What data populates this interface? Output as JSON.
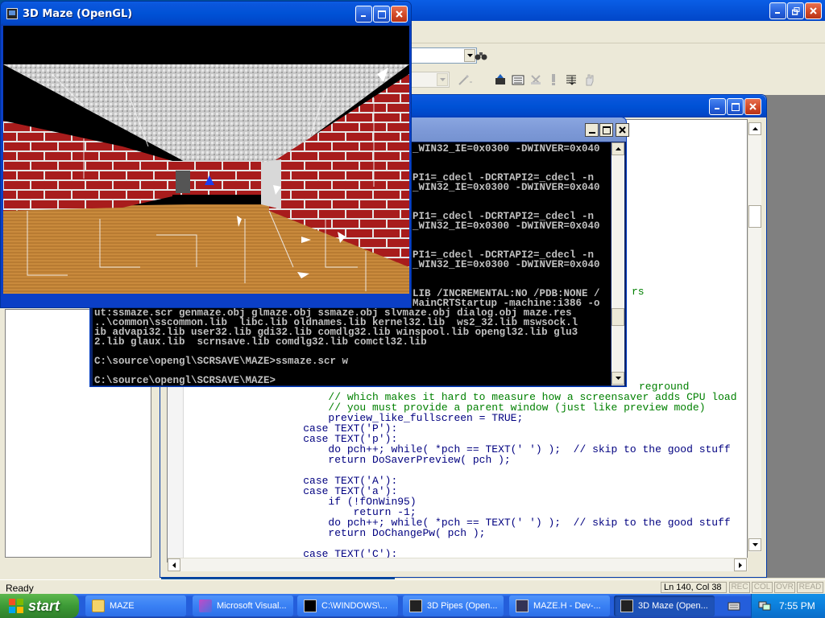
{
  "maze_window": {
    "title": "3D Maze (OpenGL)"
  },
  "devcpp": {
    "status_ready": "Ready",
    "status_pos": "Ln 140, Col 38",
    "indicators": [
      "REC",
      "COL",
      "OVR",
      "READ"
    ],
    "code_lines": [
      {
        "t": "                       // which makes it hard to measure how a screensaver adds CPU load",
        "c": "comment"
      },
      {
        "t": "                       // you must provide a parent window (just like preview mode)",
        "c": "comment"
      },
      {
        "t": "                       preview_like_fullscreen = TRUE;",
        "c": "code"
      },
      {
        "t": "                   case TEXT('P'):",
        "c": "code"
      },
      {
        "t": "                   case TEXT('p'):",
        "c": "code"
      },
      {
        "t": "                       do pch++; while( *pch == TEXT(' ') );  // skip to the good stuff",
        "c": "code"
      },
      {
        "t": "                       return DoSaverPreview( pch );",
        "c": "code"
      },
      {
        "t": "",
        "c": "code"
      },
      {
        "t": "                   case TEXT('A'):",
        "c": "code"
      },
      {
        "t": "                   case TEXT('a'):",
        "c": "code"
      },
      {
        "t": "                       if (!fOnWin95)",
        "c": "code"
      },
      {
        "t": "                           return -1;",
        "c": "code"
      },
      {
        "t": "                       do pch++; while( *pch == TEXT(' ') );  // skip to the good stuff",
        "c": "code"
      },
      {
        "t": "                       return DoChangePw( pch );",
        "c": "code"
      },
      {
        "t": "",
        "c": "code"
      },
      {
        "t": "                   case TEXT('C'):",
        "c": "code"
      }
    ],
    "peek_rs": "rs",
    "peek_fg": "reground"
  },
  "console": {
    "lines_right": [
      "_WIN32_IE=0x0300 -DWINVER=0x040",
      "",
      "",
      "PI1=_cdecl -DCRTAPI2=_cdecl -n",
      "_WIN32_IE=0x0300 -DWINVER=0x040",
      "",
      "",
      "PI1=_cdecl -DCRTAPI2=_cdecl -n",
      "_WIN32_IE=0x0300 -DWINVER=0x040",
      "",
      "",
      "PI1=_cdecl -DCRTAPI2=_cdecl -n",
      "_WIN32_IE=0x0300 -DWINVER=0x040",
      "",
      "",
      "LIB /INCREMENTAL:NO /PDB:NONE /",
      "MainCRTStartup -machine:i386 -o"
    ],
    "lines_full": [
      "ut:ssmaze.scr genmaze.obj glmaze.obj ssmaze.obj slvmaze.obj dialog.obj maze.res",
      "..\\common\\sscommon.lib  libc.lib oldnames.lib kernel32.lib  ws2_32.lib mswsock.l",
      "ib advapi32.lib user32.lib gdi32.lib comdlg32.lib winspool.lib opengl32.lib glu3",
      "2.lib glaux.lib  scrnsave.lib comdlg32.lib comctl32.lib",
      "",
      "C:\\source\\opengl\\SCRSAVE\\MAZE>ssmaze.scr w",
      "",
      "C:\\source\\opengl\\SCRSAVE\\MAZE>"
    ]
  },
  "taskbar": {
    "start_label": "start",
    "clock": "7:55 PM",
    "buttons": [
      {
        "label": "MAZE",
        "icon": "folder-icon"
      },
      {
        "label": "Microsoft Visual...",
        "icon": "visual-studio-icon"
      },
      {
        "label": "C:\\WINDOWS\\...",
        "icon": "command-prompt-icon"
      },
      {
        "label": "3D Pipes (Open...",
        "icon": "opengl-app-icon"
      },
      {
        "label": "MAZE.H - Dev-...",
        "icon": "devcpp-icon"
      },
      {
        "label": "3D Maze (Open...",
        "icon": "opengl-app-icon"
      }
    ]
  },
  "colors": {
    "xp_blue": "#0052d6",
    "taskbar": "#245edb",
    "start_green": "#3c9a36",
    "console_bg": "#000000",
    "console_fg": "#c0c0c0",
    "comment": "#008000",
    "code": "#000080"
  }
}
